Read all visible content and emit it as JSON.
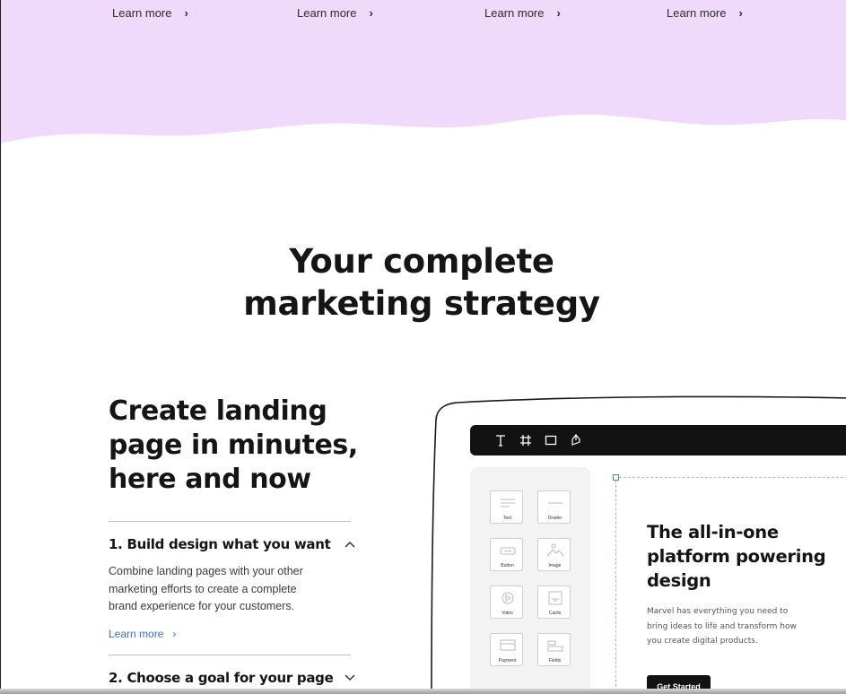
{
  "top_links": [
    {
      "label": "Learn more"
    },
    {
      "label": "Learn more"
    },
    {
      "label": "Learn more"
    },
    {
      "label": "Learn more"
    }
  ],
  "colors": {
    "hero_band": "#f0dafc",
    "link_blue": "#3a6fd8",
    "toolbar_bg": "#121212",
    "palette_bg": "#f3f3f3"
  },
  "section": {
    "title_line1": "Your complete",
    "title_line2": "marketing strategy"
  },
  "feature": {
    "heading_line1": "Create landing",
    "heading_line2": "page in minutes,",
    "heading_line3": "here and now",
    "accordion": [
      {
        "title": "1. Build design what you want",
        "expanded": true,
        "body_line1": "Combine landing pages with your other",
        "body_line2": "marketing efforts to create a complete",
        "body_line3": "brand experience for your customers.",
        "link": "Learn more"
      },
      {
        "title": "2. Choose a goal for your page",
        "expanded": false
      }
    ]
  },
  "editor": {
    "tools": [
      "text-tool-icon",
      "frame-tool-icon",
      "rectangle-tool-icon",
      "pen-tool-icon"
    ],
    "blocks": [
      {
        "label": "Text",
        "icon": "text-block-icon"
      },
      {
        "label": "Divider",
        "icon": "divider-block-icon"
      },
      {
        "label": "Button",
        "icon": "button-block-icon"
      },
      {
        "label": "Image",
        "icon": "image-block-icon"
      },
      {
        "label": "Video",
        "icon": "video-block-icon"
      },
      {
        "label": "Cards",
        "icon": "cards-block-icon"
      },
      {
        "label": "Payment",
        "icon": "payment-block-icon"
      },
      {
        "label": "Fields",
        "icon": "fields-block-icon"
      }
    ],
    "preview": {
      "title_line1": "The all-in-one",
      "title_line2": "platform powering",
      "title_line3": "design",
      "desc_line1": "Marvel has everything you need to",
      "desc_line2": "bring ideas to life and transform how",
      "desc_line3": "you create digital products.",
      "cta": "Get Started"
    }
  }
}
